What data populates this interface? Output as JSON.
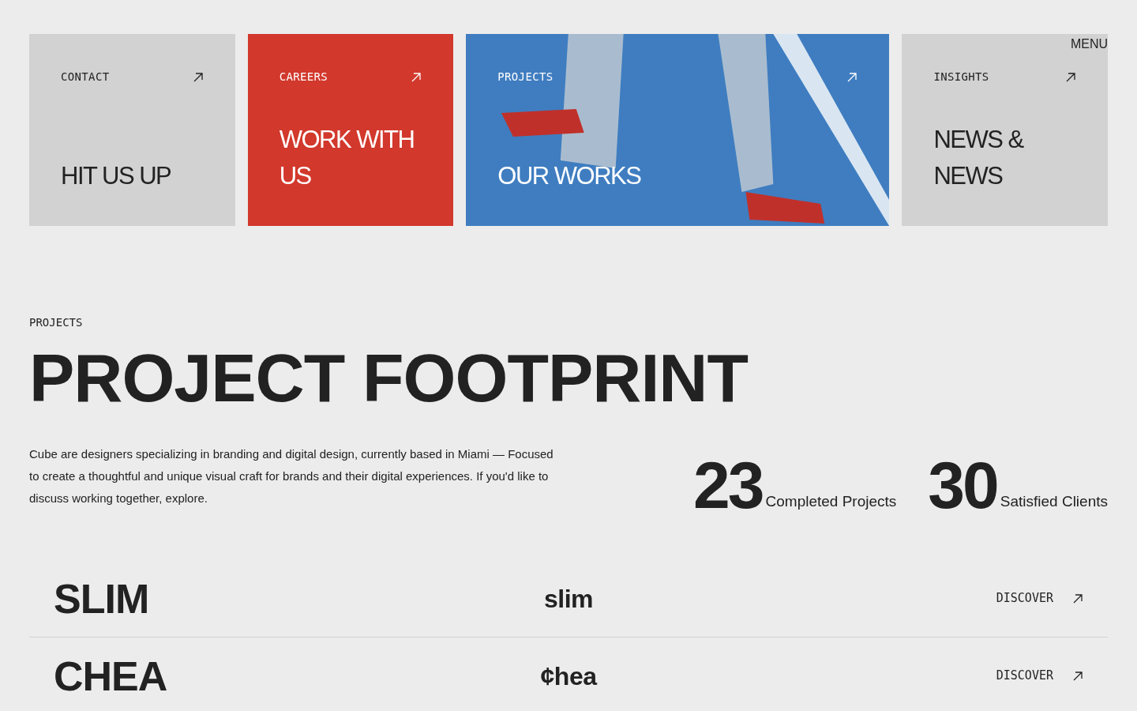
{
  "menu": {
    "label": "MENU"
  },
  "cards": [
    {
      "kind": "plain",
      "label": "CONTACT",
      "title": "HIT US UP"
    },
    {
      "kind": "accent",
      "label": "CAREERS",
      "title": "WORK WITH US"
    },
    {
      "kind": "photo",
      "label": "PROJECTS",
      "title": "OUR WORKS"
    },
    {
      "kind": "plain",
      "label": "INSIGHTS",
      "title": "NEWS & NEWS"
    }
  ],
  "section": {
    "eyebrow": "PROJECTS",
    "title": "PROJECT FOOTPRINT",
    "description": "Cube are designers specializing in branding and digital design, currently based in Miami — Focused to create a thoughtful and unique visual craft for brands and their digital experiences. If you'd like to discuss working together, explore."
  },
  "stats": [
    {
      "value": "23",
      "label": "Completed Projects"
    },
    {
      "value": "30",
      "label": "Satisfied Clients"
    }
  ],
  "projects": [
    {
      "name": "SLIM",
      "logo": "slim",
      "link": "DISCOVER"
    },
    {
      "name": "CHEA",
      "logo": "¢hea",
      "link": "DISCOVER"
    }
  ]
}
